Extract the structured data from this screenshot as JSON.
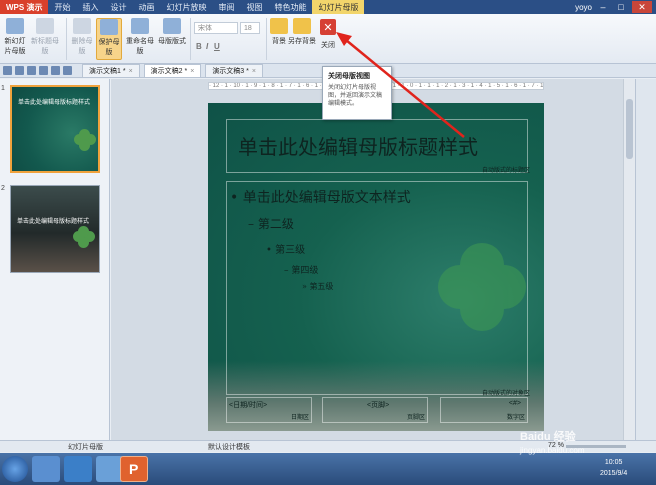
{
  "titlebar": {
    "app_name": "WPS 演示",
    "menus": [
      "开始",
      "插入",
      "设计",
      "动画",
      "幻灯片放映",
      "审阅",
      "视图",
      "特色功能",
      "幻灯片母版"
    ],
    "active_menu": "幻灯片母版",
    "user": "yoyo"
  },
  "ribbon": {
    "buttons": [
      {
        "label": "新幻灯片母版"
      },
      {
        "label": "新标题母版"
      },
      {
        "label": "删除母版"
      },
      {
        "label": "保护母版"
      },
      {
        "label": "重命名母版"
      },
      {
        "label": "母版版式"
      },
      {
        "label": "背景"
      },
      {
        "label": "另存背景"
      },
      {
        "label": "关闭"
      }
    ],
    "font_name": "宋体",
    "font_size": "18",
    "close_symbol": "✕"
  },
  "tabs": [
    {
      "label": "演示文稿1 *"
    },
    {
      "label": "演示文稿2 *"
    },
    {
      "label": "演示文稿3 *"
    }
  ],
  "tooltip": {
    "title": "关闭母版视图",
    "body": "关闭幻灯片母版视图，并返回演示文稿编辑模式。"
  },
  "slide": {
    "title": "单击此处编辑母版标题样式",
    "title_auto_label": "自动版式的标题区",
    "level1": "单击此处编辑母版文本样式",
    "level2": "第二级",
    "level3": "第三级",
    "level4": "第四级",
    "level5": "第五级",
    "body_auto_label": "自动版式的对象区",
    "footer_date": "<日期/时间>",
    "footer_date_label": "日期区",
    "footer_footer": "<页脚>",
    "footer_footer_label": "页脚区",
    "footer_number": "<#>",
    "footer_number_label": "数字区"
  },
  "thumbnails": [
    {
      "number": "1",
      "title": "单击此处编辑母版标题样式"
    },
    {
      "number": "2",
      "title": "单击此处编辑母版标题样式"
    }
  ],
  "ruler_text": "· 12 · 1 · 10 · 1 · 9 · 1 · 8 · 1 · 7 · 1 · 6 · 1 · 5 · 1 · 4 · 1 · 3 · 1 · 2 · 1 · 1 · 1 · 0 · 1 · 1 · 1 · 2 · 1 · 3 · 1 · 4 · 1 · 5 · 1 · 6 · 1 · 7 · 1 · 8 · 1 · 9 · 1 · 10 · 1 · 11 · 1 · 12 ·",
  "status": {
    "left": "幻灯片母版",
    "mid": "默认设计模板",
    "zoom": "72 %"
  },
  "taskbar": {
    "time": "10:05",
    "date": "2015/9/4"
  },
  "watermark": {
    "brand": "Baidu 经验",
    "url": "jingyan.baidu.com"
  },
  "colors": {
    "slide_bg": "#15614f",
    "accent_tab": "#f2d56b",
    "arrow": "#e0241c"
  }
}
